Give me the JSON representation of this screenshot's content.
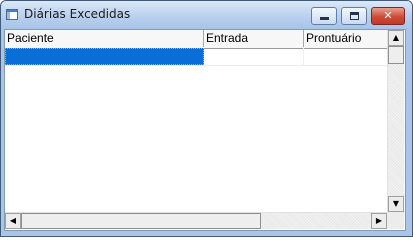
{
  "window": {
    "title": "Diárias Excedidas",
    "controls": {
      "close_glyph": "✕"
    }
  },
  "table": {
    "columns": [
      "Paciente",
      "Entrada",
      "Prontuário"
    ],
    "selected_row": 1,
    "selection_color": "#0a6ed8"
  },
  "scrollbars": {
    "vertical": {
      "up_glyph": "▲",
      "down_glyph": "▼"
    },
    "horizontal": {
      "left_glyph": "◀",
      "right_glyph": "▶"
    }
  }
}
